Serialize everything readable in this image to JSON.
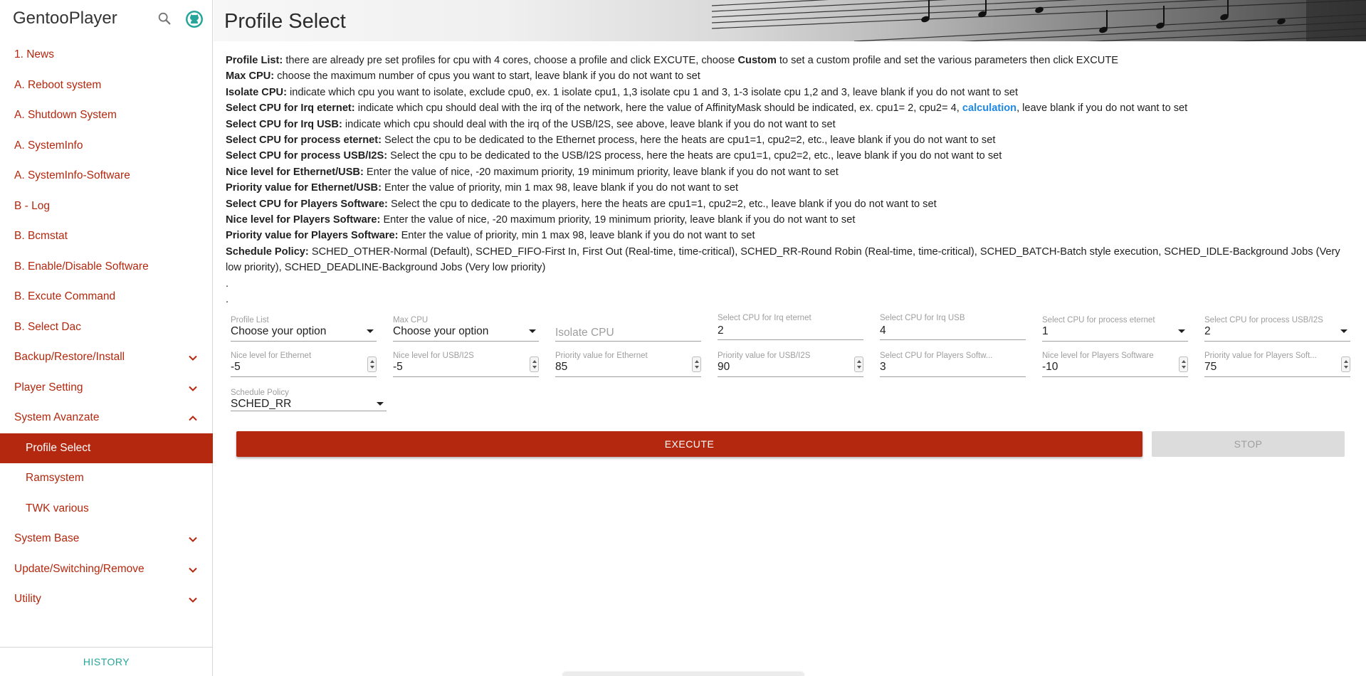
{
  "app": {
    "title": "GentooPlayer"
  },
  "sidebar": {
    "items": [
      {
        "label": "1. News"
      },
      {
        "label": "A. Reboot system"
      },
      {
        "label": "A. Shutdown System"
      },
      {
        "label": "A. SystemInfo"
      },
      {
        "label": "A. SystemInfo-Software"
      },
      {
        "label": "B - Log"
      },
      {
        "label": "B. Bcmstat"
      },
      {
        "label": "B. Enable/Disable Software"
      },
      {
        "label": "B. Excute Command"
      },
      {
        "label": "B. Select Dac"
      },
      {
        "label": "Backup/Restore/Install",
        "expandable": true
      },
      {
        "label": "Player Setting",
        "expandable": true
      },
      {
        "label": "System Avanzate",
        "expandable": true,
        "expanded": true
      },
      {
        "label": "Profile Select",
        "sub": true,
        "active": true
      },
      {
        "label": "Ramsystem",
        "sub": true
      },
      {
        "label": "TWK various",
        "sub": true
      },
      {
        "label": "System Base",
        "expandable": true
      },
      {
        "label": "Update/Switching/Remove",
        "expandable": true
      },
      {
        "label": "Utility",
        "expandable": true
      }
    ],
    "history_label": "HISTORY"
  },
  "header": {
    "title": "Profile Select"
  },
  "description": {
    "lines": [
      {
        "term": "Profile List:",
        "text": " there are already pre set profiles for cpu with 4 cores, choose a profile and click EXCUTE, choose ",
        "bold2": "Custom",
        "text2": " to set a custom profile and set the various parameters then click EXCUTE"
      },
      {
        "term": "Max CPU:",
        "text": " choose the maximum number of cpus you want to start, leave blank if you do not want to set"
      },
      {
        "term": "Isolate CPU:",
        "text": " indicate which cpu you want to isolate, exclude cpu0, ex. 1 isolate cpu1, 1,3 isolate cpu 1 and 3, 1-3 isolate cpu 1,2 and 3, leave blank if you do not want to set"
      },
      {
        "term": "Select CPU for Irq eternet:",
        "text": " indicate which cpu should deal with the irq of the network, here the value of AffinityMask should be indicated, ex. cpu1= 2, cpu2= 4, ",
        "link": "calculation",
        "text2": ", leave blank if you do not want to set"
      },
      {
        "term": "Select CPU for Irq USB:",
        "text": " indicate which cpu should deal with the irq of the USB/I2S, see above, leave blank if you do not want to set"
      },
      {
        "term": "Select CPU for process eternet:",
        "text": " Select the cpu to be dedicated to the Ethernet process, here the heats are cpu1=1, cpu2=2, etc., leave blank if you do not want to set"
      },
      {
        "term": "Select CPU for process USB/I2S:",
        "text": " Select the cpu to be dedicated to the USB/I2S process, here the heats are cpu1=1, cpu2=2, etc., leave blank if you do not want to set"
      },
      {
        "term": "Nice level for Ethernet/USB:",
        "text": " Enter the value of nice, -20 maximum priority, 19 minimum priority, leave blank if you do not want to set"
      },
      {
        "term": "Priority value for Ethernet/USB:",
        "text": " Enter the value of priority, min 1 max 98, leave blank if you do not want to set"
      },
      {
        "term": "Select CPU for Players Software:",
        "text": " Select the cpu to dedicate to the players, here the heats are cpu1=1, cpu2=2, etc., leave blank if you do not want to set"
      },
      {
        "term": "Nice level for Players Software:",
        "text": " Enter the value of nice, -20 maximum priority, 19 minimum priority, leave blank if you do not want to set"
      },
      {
        "term": "Priority value for Players Software:",
        "text": " Enter the value of priority, min 1 max 98, leave blank if you do not want to set"
      },
      {
        "term": "Schedule Policy:",
        "text": " SCHED_OTHER-Normal (Default), SCHED_FIFO-First In, First Out (Real-time, time-critical), SCHED_RR-Round Robin (Real-time, time-critical), SCHED_BATCH-Batch style execution, SCHED_IDLE-Background Jobs (Very low priority), SCHED_DEADLINE-Background Jobs (Very low priority)"
      }
    ],
    "dots": [
      ".",
      "."
    ]
  },
  "form": {
    "profile_list": {
      "label": "Profile List",
      "value": "Choose your option"
    },
    "max_cpu": {
      "label": "Max CPU",
      "value": "Choose your option"
    },
    "isolate_cpu": {
      "placeholder": "Isolate CPU"
    },
    "irq_eternet": {
      "label": "Select CPU for Irq eternet",
      "value": "2"
    },
    "irq_usb": {
      "label": "Select CPU for Irq USB",
      "value": "4"
    },
    "process_eternet": {
      "label": "Select CPU for process eternet",
      "value": "1"
    },
    "process_usb": {
      "label": "Select CPU for process USB/I2S",
      "value": "2"
    },
    "nice_ethernet": {
      "label": "Nice level for Ethernet",
      "value": "-5"
    },
    "nice_usb": {
      "label": "Nice level for USB/I2S",
      "value": "-5"
    },
    "priority_ethernet": {
      "label": "Priority value for Ethernet",
      "value": "85"
    },
    "priority_usb": {
      "label": "Priority value for USB/I2S",
      "value": "90"
    },
    "cpu_players": {
      "label": "Select CPU for Players Softw...",
      "value": "3"
    },
    "nice_players": {
      "label": "Nice level for Players Software",
      "value": "-10"
    },
    "priority_players": {
      "label": "Priority value for Players Soft...",
      "value": "75"
    },
    "schedule_policy": {
      "label": "Schedule Policy",
      "value": "SCHED_RR"
    }
  },
  "buttons": {
    "execute": "EXECUTE",
    "stop": "STOP"
  },
  "colors": {
    "accent": "#b3280e",
    "history": "#26a69a",
    "link": "#1e88e5"
  },
  "icons": {
    "search": "search-icon",
    "github": "github-icon",
    "chevron": "chevron-down-icon"
  }
}
